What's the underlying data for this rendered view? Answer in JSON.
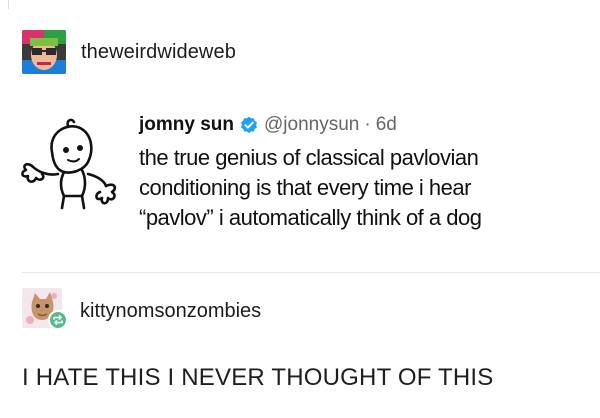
{
  "post": {
    "username": "theweirdwideweb",
    "avatar_icon": "colorful-glasses-avatar"
  },
  "tweet": {
    "name": "jomny sun",
    "verified_icon": "verified-badge-icon",
    "handle": "@jonnysun",
    "separator": "·",
    "time": "6d",
    "lines": [
      "the true genius of classical pavlovian",
      "conditioning is that every time i hear",
      "“pavlov” i automatically think of a dog"
    ],
    "avatar_icon": "alien-doodle-avatar",
    "accent_color": "#1da1f2"
  },
  "reblog": {
    "username": "kittynomsonzombies",
    "avatar_icon": "cat-avatar",
    "badge_icon": "reblog-icon",
    "badge_color": "#56bc8a",
    "text": "I HATE THIS I NEVER THOUGHT OF THIS"
  }
}
